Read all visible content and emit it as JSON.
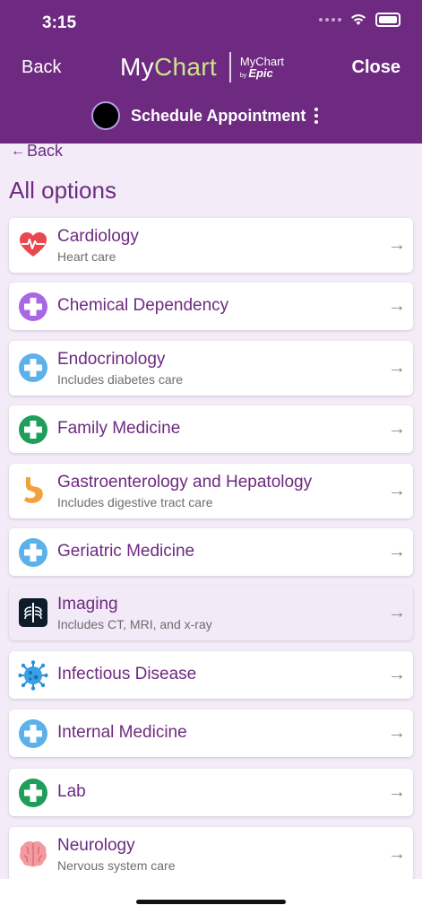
{
  "status": {
    "time": "3:15"
  },
  "header": {
    "back_label": "Back",
    "close_label": "Close",
    "logo_my": "My",
    "logo_chart": "Chart",
    "logo_epic_line1": "MyChart",
    "logo_epic_by": "by",
    "logo_epic_line2": "Epic",
    "subtitle": "Schedule Appointment"
  },
  "page": {
    "back_link": "Back",
    "section_title": "All options"
  },
  "options": [
    {
      "title": "Cardiology",
      "subtitle": "Heart care",
      "icon": "heart-rate-icon"
    },
    {
      "title": "Chemical Dependency",
      "subtitle": "",
      "icon": "purple-cross-icon"
    },
    {
      "title": "Endocrinology",
      "subtitle": "Includes diabetes care",
      "icon": "blue-cross-icon"
    },
    {
      "title": "Family Medicine",
      "subtitle": "",
      "icon": "green-cross-icon"
    },
    {
      "title": "Gastroenterology and Hepatology",
      "subtitle": "Includes digestive tract care",
      "icon": "stomach-icon"
    },
    {
      "title": "Geriatric Medicine",
      "subtitle": "",
      "icon": "blue-cross-icon"
    },
    {
      "title": "Imaging",
      "subtitle": "Includes CT, MRI, and x-ray",
      "icon": "xray-icon"
    },
    {
      "title": "Infectious Disease",
      "subtitle": "",
      "icon": "virus-icon"
    },
    {
      "title": "Internal Medicine",
      "subtitle": "",
      "icon": "blue-cross-icon"
    },
    {
      "title": "Lab",
      "subtitle": "",
      "icon": "green-cross-icon"
    },
    {
      "title": "Neurology",
      "subtitle": "Nervous system care",
      "icon": "brain-icon"
    }
  ],
  "colors": {
    "header": "#6e2a80",
    "accent_text": "#6e2a80",
    "background": "#f3ecf8",
    "logo_chart": "#cde48b"
  }
}
